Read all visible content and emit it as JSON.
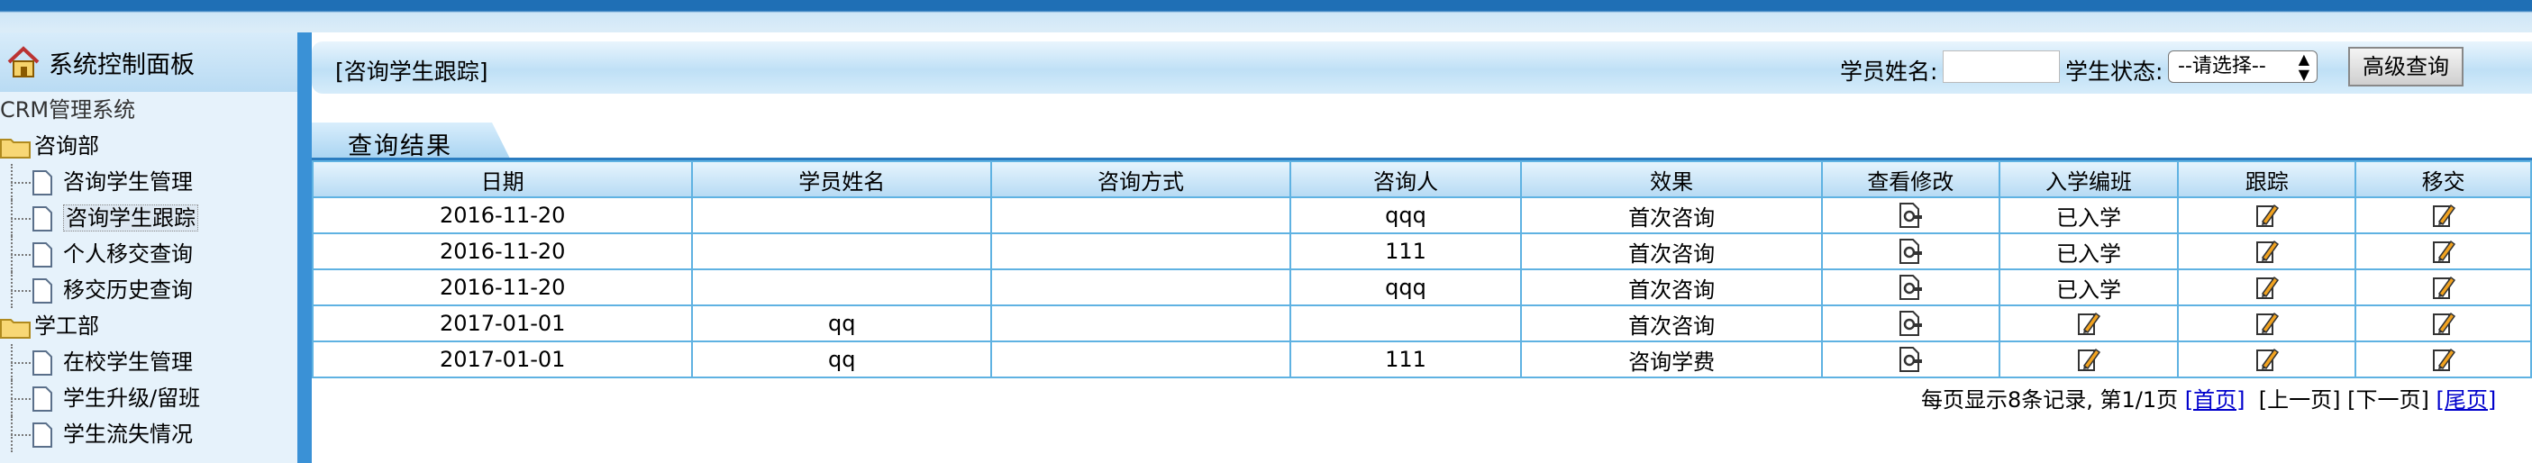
{
  "sidebar": {
    "title": "系统控制面板",
    "root": "CRM管理系统",
    "groups": [
      {
        "label": "咨询部",
        "items": [
          "咨询学生管理",
          "咨询学生跟踪",
          "个人移交查询",
          "移交历史查询"
        ]
      },
      {
        "label": "学工部",
        "items": [
          "在校学生管理",
          "学生升级/留班",
          "学生流失情况"
        ]
      }
    ]
  },
  "search": {
    "title": "[咨询学生跟踪]",
    "name_label": "学员姓名:",
    "name_value": "",
    "status_label": "学生状态:",
    "status_selected": "--请选择--",
    "advanced_button": "高级查询"
  },
  "results": {
    "tab_label": "查询结果",
    "columns": [
      "日期",
      "学员姓名",
      "咨询方式",
      "咨询人",
      "效果",
      "查看修改",
      "入学编班",
      "跟踪",
      "移交"
    ],
    "rows": [
      {
        "date": "2016-11-20",
        "name": "",
        "method": "",
        "consultant": "qqq",
        "effect": "首次咨询",
        "enroll": "已入学"
      },
      {
        "date": "2016-11-20",
        "name": "",
        "method": "",
        "consultant": "111",
        "effect": "首次咨询",
        "enroll": "已入学"
      },
      {
        "date": "2016-11-20",
        "name": "",
        "method": "",
        "consultant": "qqq",
        "effect": "首次咨询",
        "enroll": "已入学"
      },
      {
        "date": "2017-01-01",
        "name": "qq",
        "method": "",
        "consultant": "",
        "effect": "首次咨询",
        "enroll": ""
      },
      {
        "date": "2017-01-01",
        "name": "qq",
        "method": "",
        "consultant": "111",
        "effect": "咨询学费",
        "enroll": ""
      }
    ]
  },
  "pager": {
    "summary": "每页显示8条记录, 第1/1页",
    "first": "[首页]",
    "prev": "[上一页]",
    "next": "[下一页]",
    "last": "[尾页]"
  },
  "icons": {
    "home": "house-icon",
    "folder": "folder-icon",
    "page": "page-icon",
    "view": "view-edit-icon",
    "edit": "pencil-icon"
  },
  "colors": {
    "accent": "#3a91d6",
    "topbar": "#1f6fb5",
    "grid_border": "#5fb2e2",
    "link": "#0000cc"
  }
}
